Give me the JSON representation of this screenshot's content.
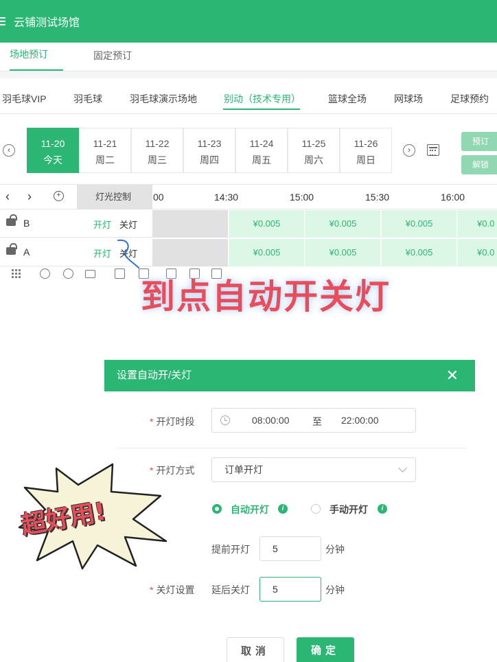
{
  "app": {
    "title": "云铺测试场馆"
  },
  "main_tabs": [
    {
      "label": "场地预订",
      "active": true
    },
    {
      "label": "固定预订",
      "active": false
    }
  ],
  "venue_tabs": [
    {
      "label": "羽毛球VIP"
    },
    {
      "label": "羽毛球"
    },
    {
      "label": "羽毛球演示场地"
    },
    {
      "label": "别动（技术专用）",
      "active": true
    },
    {
      "label": "篮球全场"
    },
    {
      "label": "网球场"
    },
    {
      "label": "足球预约"
    }
  ],
  "dates": [
    {
      "date": "11-20",
      "weekday": "今天",
      "active": true
    },
    {
      "date": "11-21",
      "weekday": "周二"
    },
    {
      "date": "11-22",
      "weekday": "周三"
    },
    {
      "date": "11-23",
      "weekday": "周四"
    },
    {
      "date": "11-24",
      "weekday": "周五"
    },
    {
      "date": "11-25",
      "weekday": "周六"
    },
    {
      "date": "11-26",
      "weekday": "周日"
    }
  ],
  "side_buttons": {
    "book": "预订",
    "unlock": "解锁"
  },
  "grid": {
    "light_control": "灯光控制",
    "times": [
      "00",
      "14:30",
      "15:00",
      "15:30",
      "16:00"
    ],
    "courts": [
      {
        "name": "B",
        "on": "开灯",
        "off": "关灯",
        "prices": [
          "¥0.005",
          "¥0.005",
          "¥0.005",
          "¥0.0"
        ]
      },
      {
        "name": "A",
        "on": "开灯",
        "off": "关灯",
        "prices": [
          "¥0.005",
          "¥0.005",
          "¥0.005",
          "¥0.0"
        ]
      }
    ]
  },
  "headline": "到点自动开关灯",
  "sticker": "超好用!",
  "dialog": {
    "title": "设置自动开/关灯",
    "close": "✕",
    "period_label": "开灯时段",
    "start_time": "08:00:00",
    "to": "至",
    "end_time": "22:00:00",
    "mode_label": "开灯方式",
    "mode_value": "订单开灯",
    "auto_label": "自动开灯",
    "manual_label": "手动开灯",
    "advance_label": "提前开灯",
    "advance_value": "5",
    "minutes": "分钟",
    "off_setting_label": "关灯设置",
    "delay_label": "延后关灯",
    "delay_value": "5",
    "cancel": "取消",
    "ok": "确定"
  },
  "colors": {
    "primary": "#2bb673",
    "price_bg": "#dcf7e6",
    "headline": "#e94d5a"
  }
}
